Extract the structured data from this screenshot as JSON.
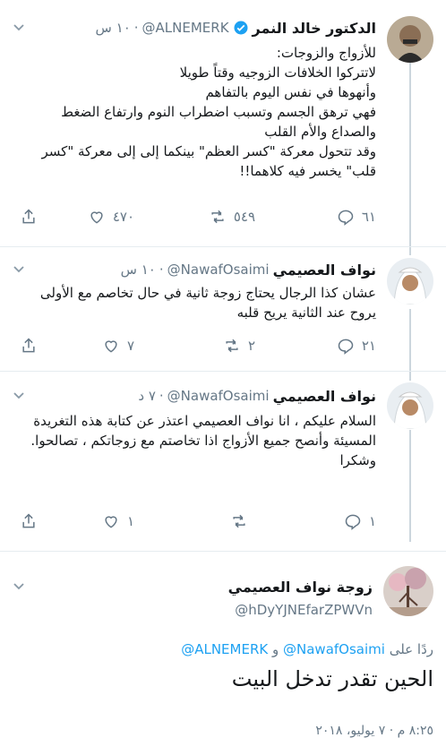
{
  "tweets": [
    {
      "name": "الدكتور خالد النمر",
      "handle": "@ALNEMERK",
      "time": "١٠ س",
      "text": "للأزواج والزوجات:\nلاتتركوا الخلافات الزوجيه وقتاً طويلا\nوأنهوها في نفس اليوم بالتفاهم\nفهي ترهق الجسم وتسبب اضطراب النوم وارتفاع الضغط والصداع والأم القلب\nوقد تتحول معركة \"كسر العظم\" بينكما إلى إلى معركة \"كسر قلب\" يخسر فيه كلاهما!!",
      "replies": "٦١",
      "retweets": "٥٤٩",
      "likes": "٤٧٠",
      "verified": true
    },
    {
      "name": "نواف العصيمي",
      "handle": "@NawafOsaimi",
      "time": "١٠ س",
      "text": "عشان كذا الرجال يحتاج زوجة ثانية في حال تخاصم مع الأولى يروح عند الثانية يريح قلبه",
      "replies": "٢١",
      "retweets": "٢",
      "likes": "٧"
    },
    {
      "name": "نواف العصيمي",
      "handle": "@NawafOsaimi",
      "time": "٧ د",
      "text": "السلام عليكم ، انا نواف العصيمي اعتذر عن كتابة هذه التغريدة المسيئة وأنصح جميع الأزواج اذا تخاصتم مع زوجاتكم ، تصالحوا.\nوشكرا",
      "replies": "١",
      "retweets": "",
      "likes": "١"
    }
  ],
  "main": {
    "name": "زوجة نواف العصيمي",
    "handle": "@hDyYJNEfarZPWVn",
    "replying_prefix": "ردًا على",
    "replying_mention1": "@NawafOsaimi",
    "replying_and": "و",
    "replying_mention2": "@ALNEMERK",
    "text": "الحين تقدر تدخل البيت",
    "timestamp": "٨:٢٥ م · ٧ يوليو، ٢٠١٨"
  },
  "colors": {
    "accent": "#1da1f2",
    "muted": "#657786",
    "thread_line": "#ccd6dd"
  },
  "icons": [
    "chevron-down-icon",
    "verified-icon",
    "reply-icon",
    "retweet-icon",
    "like-icon",
    "share-icon"
  ]
}
